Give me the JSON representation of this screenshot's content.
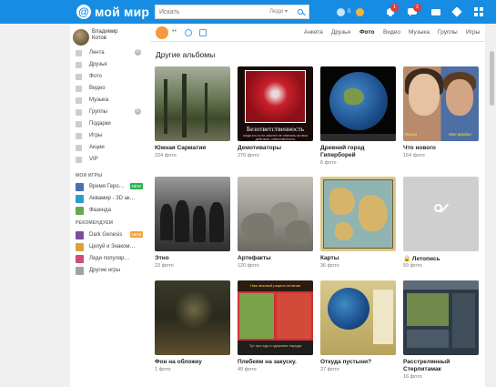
{
  "header": {
    "logo_text": "мой мир",
    "search_placeholder": "Искать",
    "search_scope": "Люди",
    "coins": "0",
    "notifications_badge": "1",
    "messages_badge": "2"
  },
  "sidebar": {
    "user_first": "Владимир",
    "user_last": "Котов",
    "items": [
      {
        "label": "Лента",
        "count": "6"
      },
      {
        "label": "Друзья"
      },
      {
        "label": "Фото"
      },
      {
        "label": "Видео"
      },
      {
        "label": "Музыка"
      },
      {
        "label": "Группы",
        "count": "6"
      },
      {
        "label": "Подарки"
      },
      {
        "label": "Игры"
      },
      {
        "label": "Акции"
      },
      {
        "label": "VIP"
      }
    ],
    "my_games_title": "МОИ ИГРЫ",
    "my_games": [
      {
        "label": "Время Геро…",
        "badge": "NEW",
        "color": "#4b6fb0"
      },
      {
        "label": "Аквамир - 3D ак…",
        "color": "#2aa0c8"
      },
      {
        "label": "Фазенда",
        "color": "#6aa84f"
      }
    ],
    "recommended_title": "РЕКОМЕНДУЕМ",
    "recommended": [
      {
        "label": "Dark Genesis",
        "badge": "NEW",
        "color": "#7a4fa0"
      },
      {
        "label": "Целуй и Знаком…",
        "color": "#d9a436"
      },
      {
        "label": "Леди популяр…",
        "color": "#d04a7a"
      },
      {
        "label": "Другие игры",
        "color": "#9aa4ad"
      }
    ]
  },
  "main": {
    "tabs": [
      "Анкета",
      "Друзья",
      "Фото",
      "Видео",
      "Музыка",
      "Группы",
      "Игры"
    ],
    "active_tab": "Фото",
    "section_title": "Другие альбомы",
    "albums": [
      {
        "title": "Южная Сарматия",
        "count": "224 фото"
      },
      {
        "title": "Демотиваторы",
        "count": "276 фото",
        "caption": "Безответственность",
        "subcaption": "когда кто-то не захотел не отвечать за свои действия, ответственность"
      },
      {
        "title": "Древний город Гиперборей",
        "count": "6 фото"
      },
      {
        "title": "Что нового",
        "count": "164 фото",
        "label_left": "Ирина",
        "label_right": "Мне вредно"
      },
      {
        "title": "Этно",
        "count": "23 фото"
      },
      {
        "title": "Артефакты",
        "count": "120 фото"
      },
      {
        "title": "Карты",
        "count": "36 фото"
      },
      {
        "title": "🔒 Летопись",
        "count": "59 фото"
      },
      {
        "title": "Фон на обложку",
        "count": "1 фото"
      },
      {
        "title": "Плебеям на закуску.",
        "count": "49 фото",
        "banner": "Наш вековой рацион питания",
        "footer": "Тут про еду и здоровье народа"
      },
      {
        "title": "Откуда пустыни?",
        "count": "27 фото"
      },
      {
        "title": "Расстрелянный Стерлитамак",
        "count": "16 фото"
      }
    ]
  },
  "colors": {
    "brand": "#168de2",
    "badge_red": "#e23b3b",
    "new_badge": "#2ab24b",
    "hit_badge": "#f3a33a"
  }
}
